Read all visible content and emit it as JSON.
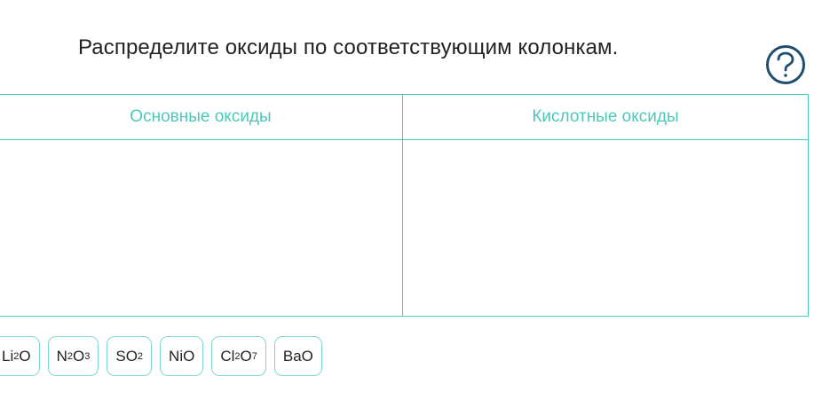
{
  "task": {
    "instruction": "Распределите оксиды по соответствующим колонкам."
  },
  "help": {
    "icon": "question-circle-icon",
    "glyph": "?"
  },
  "columns": [
    {
      "label": "Основные оксиды"
    },
    {
      "label": "Кислотные оксиды"
    }
  ],
  "tiles": [
    {
      "parts": [
        {
          "t": "Li"
        },
        {
          "s": "2"
        },
        {
          "t": "O"
        }
      ]
    },
    {
      "parts": [
        {
          "t": "N"
        },
        {
          "s": "2"
        },
        {
          "t": "O"
        },
        {
          "s": "3"
        }
      ]
    },
    {
      "parts": [
        {
          "t": "SO"
        },
        {
          "s": "2"
        }
      ]
    },
    {
      "parts": [
        {
          "t": "NiO"
        }
      ]
    },
    {
      "parts": [
        {
          "t": "Cl"
        },
        {
          "s": "2"
        },
        {
          "t": "O"
        },
        {
          "s": "7"
        }
      ]
    },
    {
      "parts": [
        {
          "t": "BaO"
        }
      ]
    }
  ],
  "colors": {
    "accent": "#4ec7bb",
    "help": "#1f4e6e",
    "text": "#222222"
  }
}
